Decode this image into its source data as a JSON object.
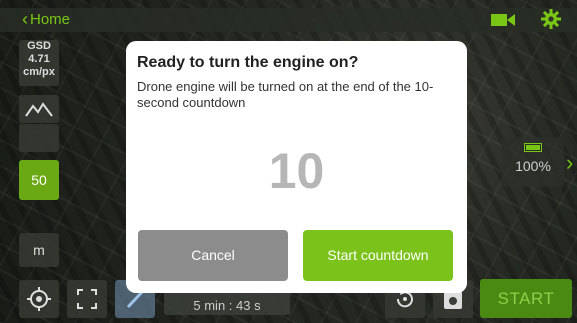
{
  "colors": {
    "accent": "#7ac614",
    "start_countdown_bg": "#7bc21b",
    "cancel_bg": "#8c8c8c",
    "altitude_bg": "#6aa814",
    "countdown_text": "#b6b6b6"
  },
  "topbar": {
    "home_label": "Home",
    "home_icon": "chevron-left-icon",
    "camera_icon": "video-camera-icon",
    "settings_icon": "gear-icon"
  },
  "sidebar": {
    "gsd_label": "GSD",
    "gsd_value": "4.71",
    "gsd_unit": "cm/px",
    "altitude_icon": "mountain-icon",
    "altitude_value": "50",
    "unit": "m"
  },
  "battery": {
    "percent": "100%",
    "icon": "battery-icon"
  },
  "bottom": {
    "flight_time": "5 min : 43 s",
    "start_label": "START",
    "target_icon": "target-icon",
    "fullscreen_icon": "fullscreen-icon",
    "edit_icon": "pencil-icon",
    "rotate_icon": "rotate-icon",
    "capture_icon": "capture-icon"
  },
  "modal": {
    "title": "Ready to turn the engine on?",
    "message": "Drone engine will be turned on at the end of the 10-second countdown",
    "countdown": "10",
    "cancel_label": "Cancel",
    "start_countdown_label": "Start countdown"
  }
}
